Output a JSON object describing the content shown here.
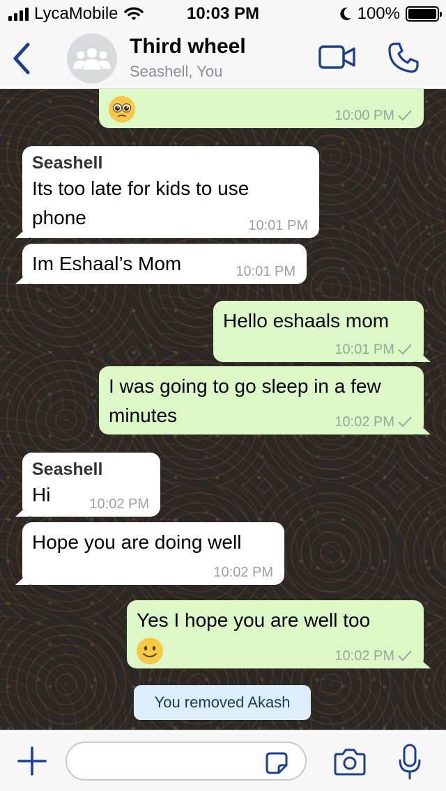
{
  "status": {
    "carrier": "LycaMobile",
    "time": "10:03 PM",
    "battery": "100%"
  },
  "header": {
    "title": "Third wheel",
    "subtitle": "Seashell, You"
  },
  "messages": [
    {
      "text": "",
      "time": "10:00 PM"
    },
    {
      "sender": "Seashell",
      "text": "Its too late for kids to use phone",
      "time": "10:01 PM"
    },
    {
      "text": "Im Eshaal’s Mom",
      "time": "10:01 PM"
    },
    {
      "text": "Hello eshaals mom",
      "time": "10:01 PM"
    },
    {
      "text": "I was going to go sleep in a few minutes",
      "time": "10:02 PM"
    },
    {
      "sender": "Seashell",
      "text": "Hi",
      "time": "10:02 PM"
    },
    {
      "text": "Hope you are doing well",
      "time": "10:02 PM"
    },
    {
      "text": "Yes I hope you are well too",
      "time": "10:02 PM"
    }
  ],
  "system_message": "You removed Akash",
  "input": {
    "placeholder": ""
  },
  "colors": {
    "accent": "#1c3f94",
    "outgoing": "#dcf8c6",
    "incoming": "#ffffff",
    "system": "#dbeefa"
  },
  "icons": [
    "back-chevron-icon",
    "group-avatar-icon",
    "video-call-icon",
    "phone-icon",
    "wifi-icon",
    "moon-icon",
    "plus-icon",
    "sticker-icon",
    "camera-icon",
    "microphone-icon",
    "pleading-face-emoji",
    "smiling-face-emoji",
    "read-check-icon"
  ]
}
